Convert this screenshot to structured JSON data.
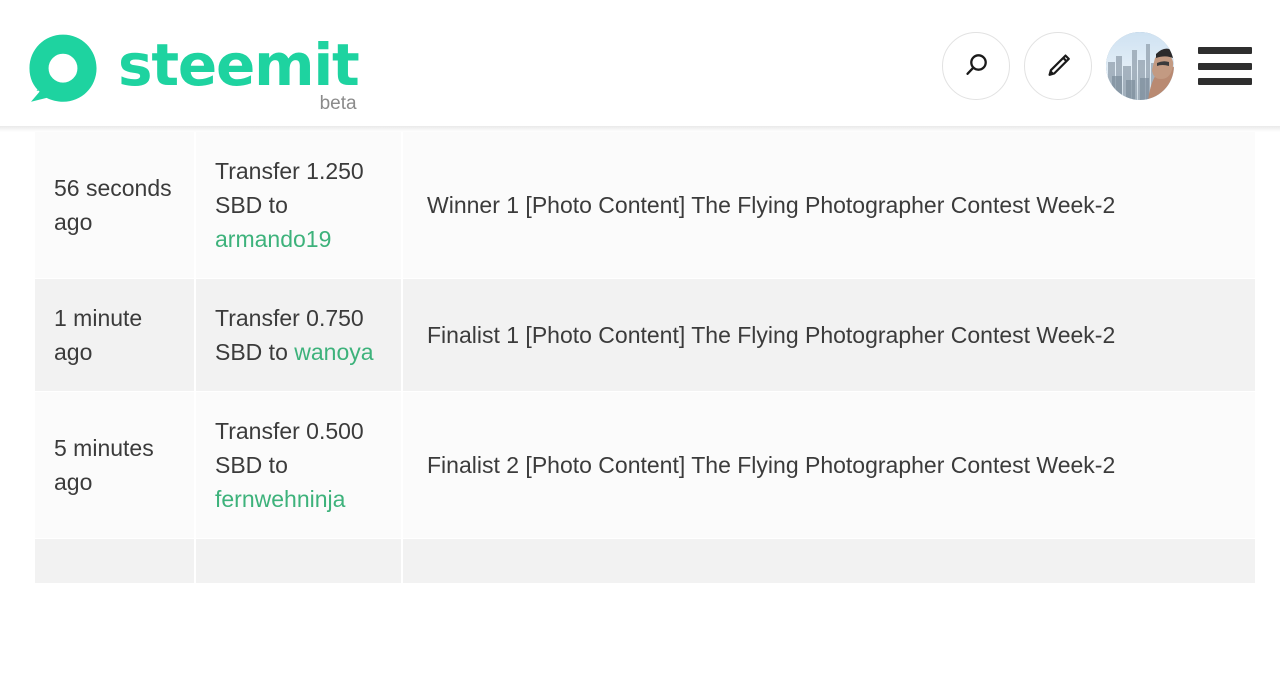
{
  "header": {
    "brand_name": "steemit",
    "brand_tag": "beta",
    "brand_color": "#1ED3A0",
    "actions": [
      {
        "name": "search",
        "label": "Search",
        "icon": "search-icon"
      },
      {
        "name": "compose",
        "label": "Create a post",
        "icon": "pencil-icon"
      }
    ],
    "avatar_label": "User profile avatar",
    "menu_label": "Menu"
  },
  "accent_color": "#3DB27B",
  "table": {
    "rows": [
      {
        "time": "56 seconds ago",
        "operation_prefix": "Transfer 1.250 SBD to ",
        "recipient": "armando19",
        "description": "Winner 1 [Photo Content] The Flying Photographer Contest Week-2"
      },
      {
        "time": "1 minute ago",
        "operation_prefix": "Transfer 0.750 SBD to ",
        "recipient": "wanoya",
        "description": "Finalist 1 [Photo Content] The Flying Photographer Contest Week-2"
      },
      {
        "time": "5 minutes ago",
        "operation_prefix": "Transfer 0.500 SBD to ",
        "recipient": "fernwehninja",
        "description": "Finalist 2 [Photo Content] The Flying Photographer Contest Week-2"
      },
      {
        "time": "",
        "operation_prefix": "",
        "recipient": "",
        "description": ""
      }
    ]
  }
}
